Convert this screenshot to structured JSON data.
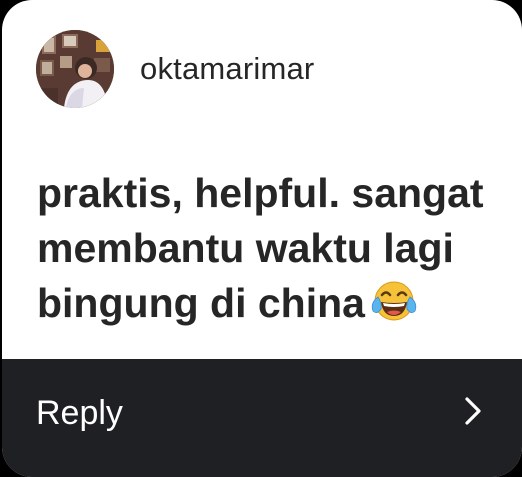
{
  "post": {
    "username": "oktamarimar",
    "message_line1": "praktis, helpful. sangat",
    "message_line2": "membantu waktu lagi",
    "message_line3": "bingung di china",
    "emoji": "face-with-tears-of-joy-icon"
  },
  "footer": {
    "reply_label": "Reply",
    "chevron_icon": "chevron-right-icon"
  },
  "colors": {
    "text": "#262626",
    "footer_bg": "#1f2023",
    "footer_text": "#ffffff",
    "card_bg": "#ffffff"
  }
}
